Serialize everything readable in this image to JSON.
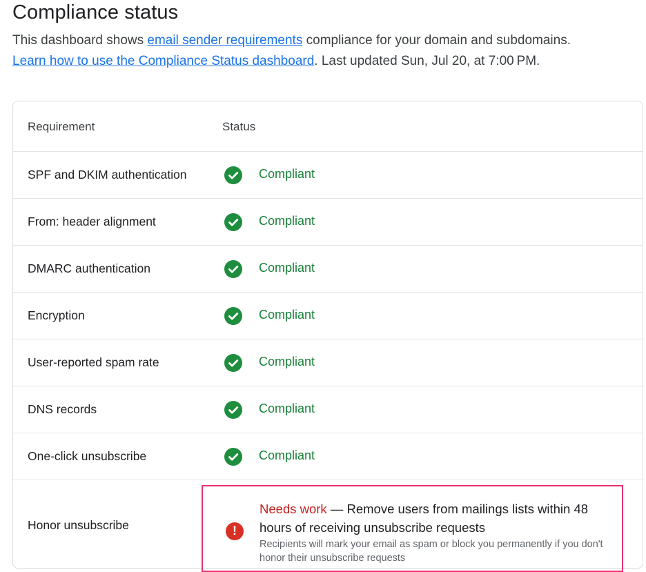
{
  "page": {
    "title": "Compliance status",
    "desc_prefix": "This dashboard shows ",
    "desc_link1": "email sender requirements",
    "desc_mid": " compliance for your domain and subdomains.",
    "desc_link2": "Learn how to use the Compliance Status dashboard",
    "desc_suffix": ". Last updated Sun, Jul 20, at 7:00 PM."
  },
  "table": {
    "headers": {
      "requirement": "Requirement",
      "status": "Status"
    },
    "rows": [
      {
        "requirement": "SPF and DKIM authentication",
        "status": "Compliant"
      },
      {
        "requirement": "From: header alignment",
        "status": "Compliant"
      },
      {
        "requirement": "DMARC authentication",
        "status": "Compliant"
      },
      {
        "requirement": "Encryption",
        "status": "Compliant"
      },
      {
        "requirement": "User-reported spam rate",
        "status": "Compliant"
      },
      {
        "requirement": "DNS records",
        "status": "Compliant"
      },
      {
        "requirement": "One-click unsubscribe",
        "status": "Compliant"
      }
    ],
    "last_row": {
      "requirement": "Honor unsubscribe",
      "status_label": "Needs work",
      "dash": " — ",
      "message": "Remove users from mailings lists within 48 hours of receiving unsubscribe requests",
      "detail": "Recipients will mark your email as spam or block you permanently if you don't honor their unsubscribe requests"
    }
  },
  "colors": {
    "compliant": "#188038",
    "needs_work": "#c5221f",
    "link": "#1a73e8",
    "highlight_border": "#e8336d"
  }
}
